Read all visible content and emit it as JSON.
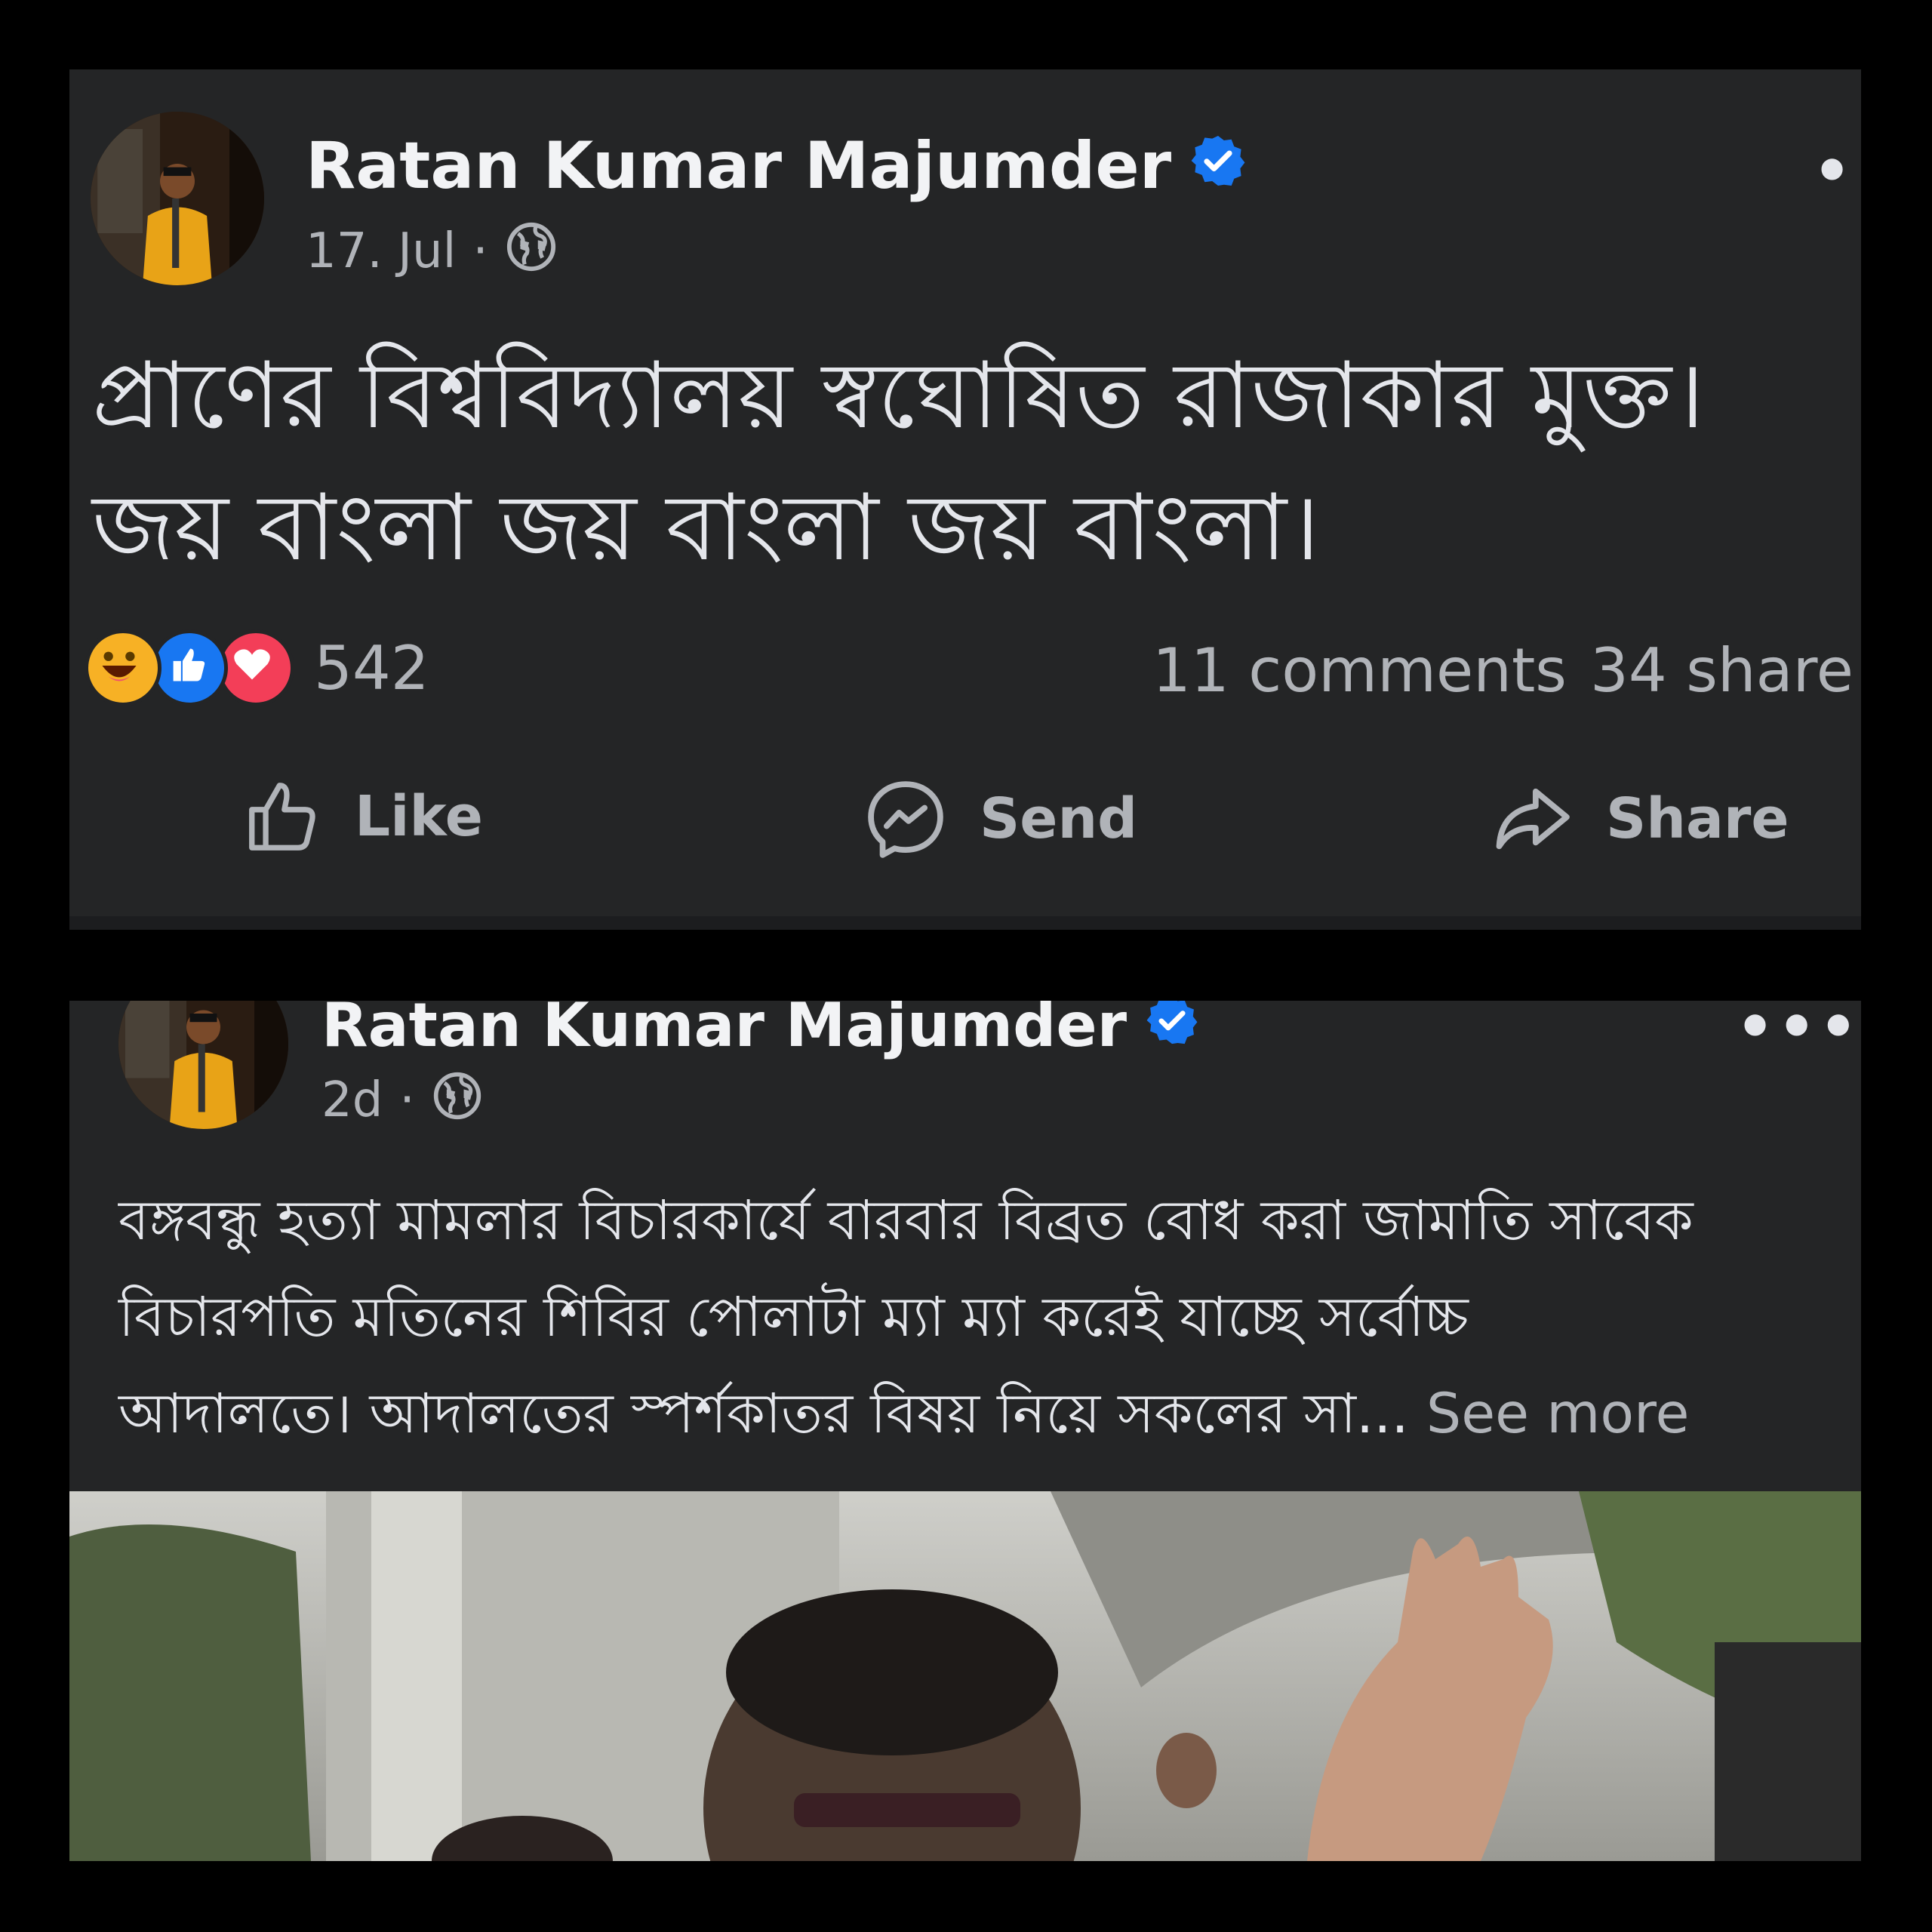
{
  "posts": [
    {
      "author": "Ratan Kumar Majumder",
      "date": "17. Jul",
      "text_line1": "প্রাণের বিশ্ববিদ্যালয় স্বঘোষিত রাজাকার মুক্ত।",
      "text_line2": "জয় বাংলা জয় বাংলা জয় বাংলা।",
      "reaction_count": "542",
      "comments": "11 comments",
      "shares": "34 share",
      "actions": {
        "like": "Like",
        "send": "Send",
        "share": "Share"
      }
    },
    {
      "author": "Ratan Kumar Majumder",
      "date": "2d",
      "text_line1": "বঙ্গবন্ধু হত্যা মামলার বিচারকার্যে বারবার বিব্রত বোধ করা জামাতি সাবেক",
      "text_line2": "বিচারপতি মতিনের শিবির পোলাটা ম্যা ম্যা করেই যাচ্ছে সর্বোচ্চ",
      "text_line3": "আদালতে। আদালতের স্পর্শকাতর বিষয় নিয়ে সকলের সা...",
      "see_more": "See more"
    }
  ],
  "colors": {
    "card_bg": "#242526",
    "page_bg": "#000000",
    "verified": "#1877f2",
    "secondary_text": "#b0b3b8"
  }
}
